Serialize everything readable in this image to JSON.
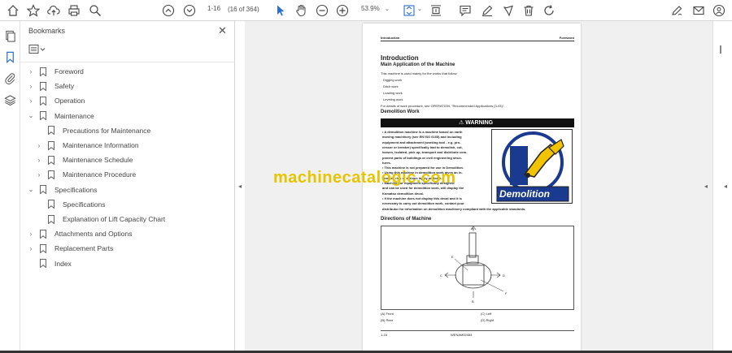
{
  "toolbar": {
    "page_value": "1-16",
    "page_count": "(16 of 364)",
    "zoom": "53.9%"
  },
  "bookmarks_panel": {
    "title": "Bookmarks",
    "items": [
      {
        "label": "Foreword",
        "expander": "›"
      },
      {
        "label": "Safety",
        "expander": "›"
      },
      {
        "label": "Operation",
        "expander": "›"
      },
      {
        "label": "Maintenance",
        "expander": "⌄"
      },
      {
        "label": "Precautions for Maintenance",
        "expander": ""
      },
      {
        "label": "Maintenance Information",
        "expander": "›"
      },
      {
        "label": "Maintenance Schedule",
        "expander": "›"
      },
      {
        "label": "Maintenance Procedure",
        "expander": "›"
      },
      {
        "label": "Specifications",
        "expander": "⌄"
      },
      {
        "label": "Specifications",
        "expander": ""
      },
      {
        "label": "Explanation of Lift Capacity Chart",
        "expander": ""
      },
      {
        "label": "Attachments and Options",
        "expander": "›"
      },
      {
        "label": "Replacement Parts",
        "expander": "›"
      },
      {
        "label": "Index",
        "expander": ""
      }
    ]
  },
  "pdf": {
    "header_left": "Introduction",
    "header_right": "Foreword",
    "title": "Introduction",
    "section1": "Main Application of the Machine",
    "intro_line": "This machine is used mainly for the works that follow:",
    "works": [
      "Digging work",
      "Ditch work",
      "Loading work",
      "Leveling work"
    ],
    "details": "For details of work procedure, see OPERATION, \"Recommended Applications (3-93)\".",
    "section2": "Demolition Work",
    "warning": "WARNING",
    "warning_lines": [
      "•  A demolition machine is a machine based on earth",
      "   moving machinery (see EN ISO 6165) and including",
      "   equipment and attachment (working tool - e.g. pro-",
      "   cessor or breaker) specifically had to demolish, cut,",
      "   loosen, isolated, pick up, transport and distribute com-",
      "   ponent parts of buildings or civil engineering struc-",
      "   tures.",
      "•  This machine is not prepared for use in Demolition.",
      "•  Using this machine in demolition work gives an in-",
      "   creased risk of serious injury or death.",
      "•  Machines or equipment specifically designed",
      "   and can be used for demolition work, will display the",
      "   Komatsu demolition decal.",
      "•  If the machine does not display this decal and it is",
      "   necessary to carry out demolition work, contact your",
      "   distributor for information on demolition machinery compliant with the applicable standards."
    ],
    "decal_text": "Demolition",
    "section3": "Directions of Machine",
    "legend": [
      "(A) Front",
      "(B) Rear",
      "(C) Left",
      "(D) Right"
    ],
    "footer_left": "1-16",
    "footer_center": "WENAM02484",
    "figure_labels": [
      "A",
      "B",
      "C",
      "D",
      "E",
      "F"
    ]
  },
  "watermark": "machinecatalogic.com"
}
